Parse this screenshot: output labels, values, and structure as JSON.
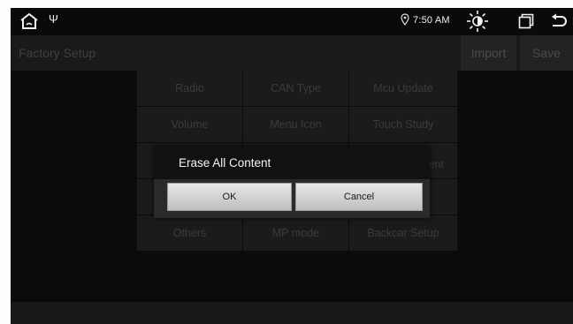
{
  "statusbar": {
    "time": "7:50 AM",
    "icons": [
      "home-icon",
      "usb-icon",
      "location-icon",
      "brightness-icon",
      "window-icon",
      "back-icon"
    ]
  },
  "header": {
    "title": "Factory Setup",
    "import_label": "Import",
    "save_label": "Save"
  },
  "grid": {
    "items": [
      {
        "label": "Radio"
      },
      {
        "label": "CAN Type"
      },
      {
        "label": "Mcu Update"
      },
      {
        "label": "Volume"
      },
      {
        "label": "Menu Icon"
      },
      {
        "label": "Touch Study"
      },
      {
        "label": ""
      },
      {
        "label": ""
      },
      {
        "label": ""
      },
      {
        "label": ""
      },
      {
        "label": ""
      },
      {
        "label": ""
      },
      {
        "label": "Others"
      },
      {
        "label": "MP mode"
      },
      {
        "label": "Backcar Setup"
      }
    ],
    "peek_text": "ent"
  },
  "dialog": {
    "title": "Erase All Content",
    "ok_label": "OK",
    "cancel_label": "Cancel"
  },
  "colors": {
    "background": "#0b0b0b",
    "dimmed_text": "#3b3b3b",
    "dialog_title_bg": "#111111",
    "button_bg": "#d9d9d9"
  }
}
